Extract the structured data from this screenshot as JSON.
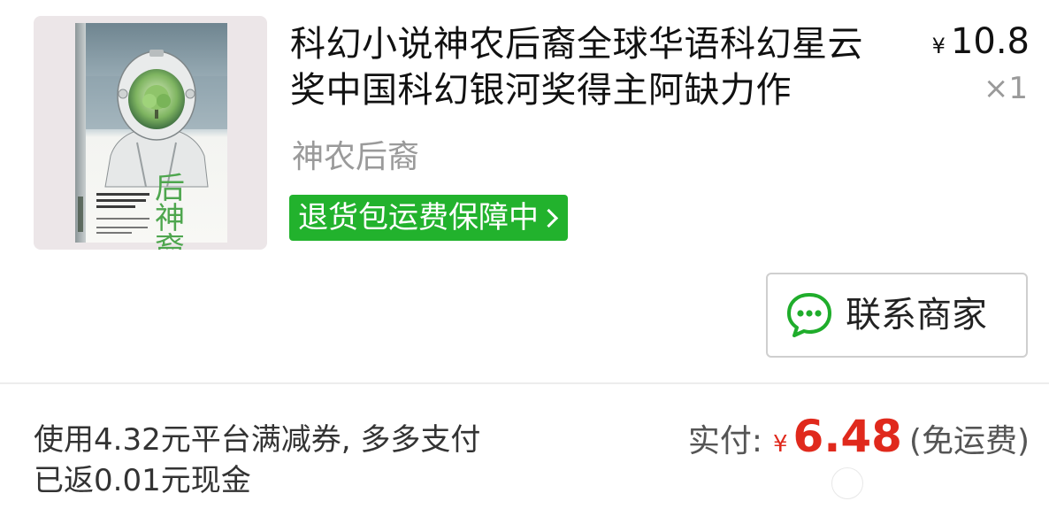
{
  "product": {
    "title": "科幻小说神农后裔全球华语科幻星云奖中国科幻银河奖得主阿缺力作",
    "subtitle": "神农后裔",
    "price_symbol": "¥",
    "price": "10.8",
    "quantity": "×1",
    "badge_label": "退货包运费保障中",
    "cover_title_line1": "后神",
    "cover_title_line2": "裔农"
  },
  "actions": {
    "contact_label": "联系商家",
    "contact_icon": "chat-bubble-icon"
  },
  "summary": {
    "promo_text": "使用4.32元平台满减券, 多多支付已返0.01元现金",
    "paid_label": "实付:",
    "paid_symbol": "¥",
    "paid_amount": "6.48",
    "shipping_note": "(免运费)"
  },
  "colors": {
    "badge_green": "#22b22d",
    "price_red": "#e0291c",
    "chat_green": "#1fad2b"
  }
}
